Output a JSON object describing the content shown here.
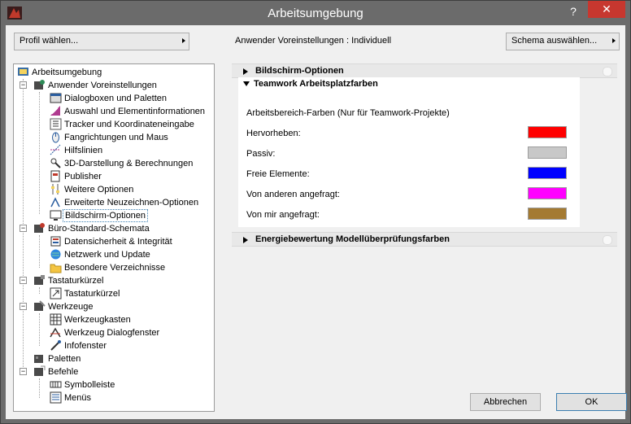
{
  "window": {
    "title": "Arbeitsumgebung",
    "help": "?",
    "close": "✕"
  },
  "top": {
    "profil_button": "Profil wählen...",
    "anwender_text": "Anwender Voreinstellungen : Individuell",
    "schema_button": "Schema auswählen..."
  },
  "tree": {
    "root": "Arbeitsumgebung",
    "anwender": {
      "label": "Anwender Voreinstellungen",
      "children": [
        "Dialogboxen und Paletten",
        "Auswahl und Elementinformationen",
        "Tracker und Koordinateneingabe",
        "Fangrichtungen und Maus",
        "Hilfslinien",
        "3D-Darstellung & Berechnungen",
        "Publisher",
        "Weitere Optionen",
        "Erweiterte Neuzeichnen-Optionen",
        "Bildschirm-Optionen"
      ]
    },
    "buero": {
      "label": "Büro-Standard-Schemata",
      "children": [
        "Datensicherheit & Integrität",
        "Netzwerk und Update",
        "Besondere Verzeichnisse"
      ]
    },
    "tastatur": {
      "label": "Tastaturkürzel",
      "children": [
        "Tastaturkürzel"
      ]
    },
    "werkzeuge": {
      "label": "Werkzeuge",
      "children": [
        "Werkzeugkasten",
        "Werkzeug Dialogfenster",
        "Infofenster"
      ]
    },
    "paletten": {
      "label": "Paletten"
    },
    "befehle": {
      "label": "Befehle",
      "children": [
        "Symbolleiste",
        "Menüs"
      ]
    }
  },
  "right": {
    "section1": "Bildschirm-Optionen",
    "section2": "Teamwork Arbeitsplatzfarben",
    "section3": "Energiebewertung Modellüberprüfungsfarben",
    "teamwork": {
      "intro": "Arbeitsbereich-Farben (Nur für Teamwork-Projekte)",
      "rows": [
        {
          "label": "Hervorheben:",
          "color": "#ff0000"
        },
        {
          "label": "Passiv:",
          "color": "#c8c8c8"
        },
        {
          "label": "Freie Elemente:",
          "color": "#0000ff"
        },
        {
          "label": "Von anderen angefragt:",
          "color": "#ff00ff"
        },
        {
          "label": "Von mir angefragt:",
          "color": "#a47a32"
        }
      ]
    }
  },
  "footer": {
    "cancel": "Abbrechen",
    "ok": "OK"
  }
}
